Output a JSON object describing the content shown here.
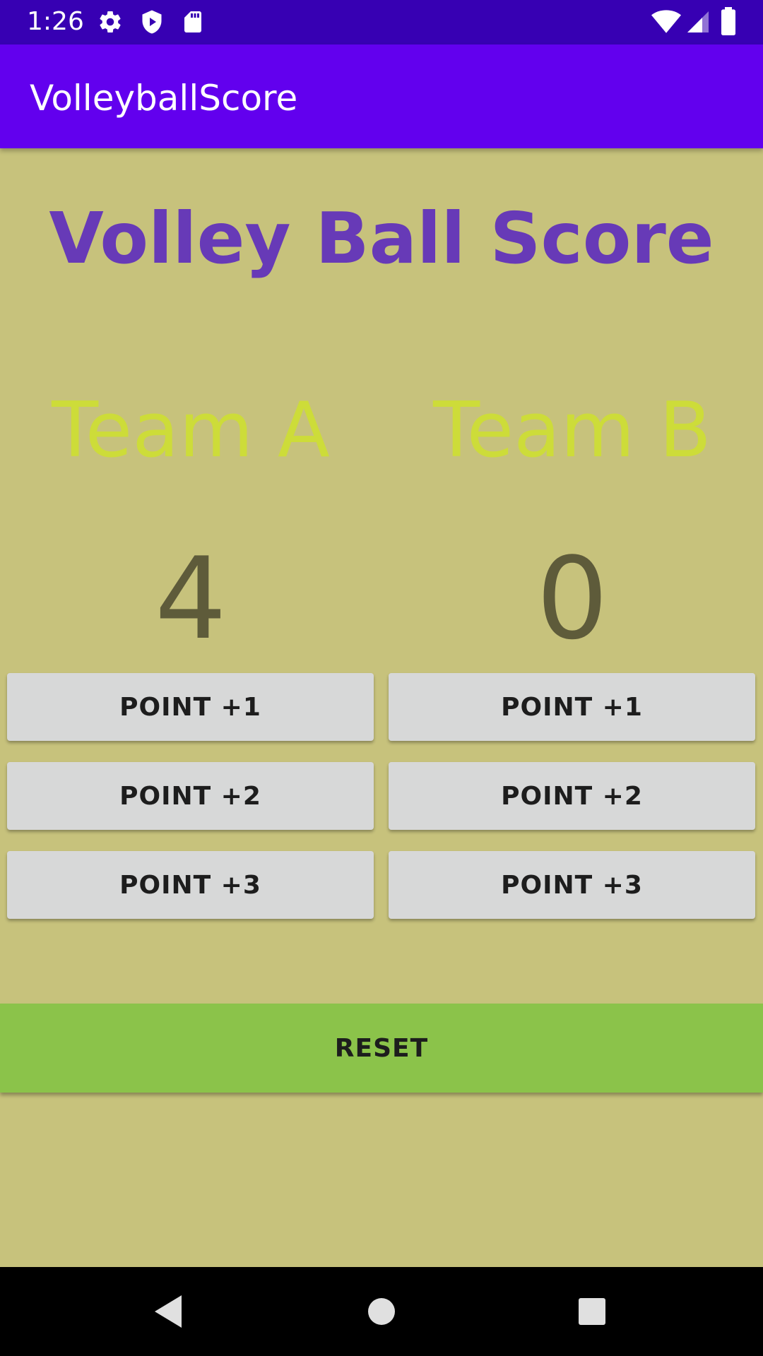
{
  "status_bar": {
    "time": "1:26",
    "left_icons": [
      "gear-icon",
      "shield-play-icon",
      "sd-card-icon"
    ],
    "right_icons": [
      "wifi-icon",
      "signal-icon",
      "battery-icon"
    ]
  },
  "app_bar": {
    "title": "VolleyballScore"
  },
  "main": {
    "heading": "Volley Ball Score",
    "team_a": {
      "name": "Team A",
      "score": "4",
      "buttons": [
        "POINT +1",
        "POINT +2",
        "POINT +3"
      ]
    },
    "team_b": {
      "name": "Team B",
      "score": "0",
      "buttons": [
        "POINT +1",
        "POINT +2",
        "POINT +3"
      ]
    },
    "reset_label": "RESET"
  },
  "nav_bar": {
    "icons": [
      "back-icon",
      "home-icon",
      "recents-icon"
    ]
  },
  "colors": {
    "status_bar": "#3700B3",
    "app_bar": "#6200EE",
    "background": "#C7C27C",
    "heading": "#673AB7",
    "team_name": "#CDDC39",
    "score": "#5E5B3A",
    "button": "#D7D8D8",
    "reset": "#8BC34A"
  }
}
